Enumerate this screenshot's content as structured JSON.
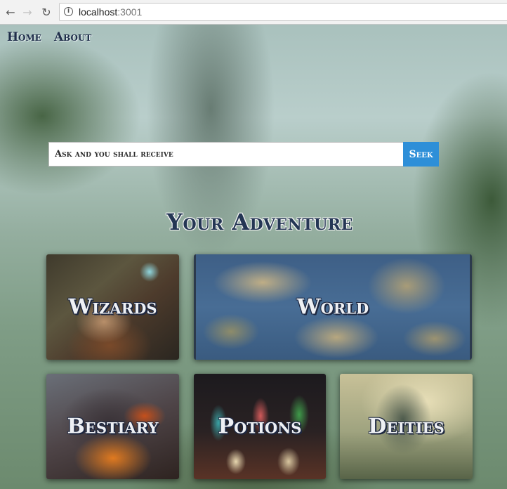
{
  "browser": {
    "back_icon": "arrow-left-icon",
    "forward_icon": "arrow-right-icon",
    "reload_icon": "reload-icon",
    "info_icon": "info-icon",
    "url_host": "localhost",
    "url_port": ":3001"
  },
  "nav": {
    "home": "Home",
    "about": "About"
  },
  "search": {
    "placeholder": "Ask and you shall receive",
    "button": "Seek",
    "button_color": "#2e8fd8"
  },
  "heading": "Your Adventure",
  "cards": {
    "wizards": "Wizards",
    "world": "World",
    "bestiary": "Bestiary",
    "potions": "Potions",
    "deities": "Deities"
  }
}
